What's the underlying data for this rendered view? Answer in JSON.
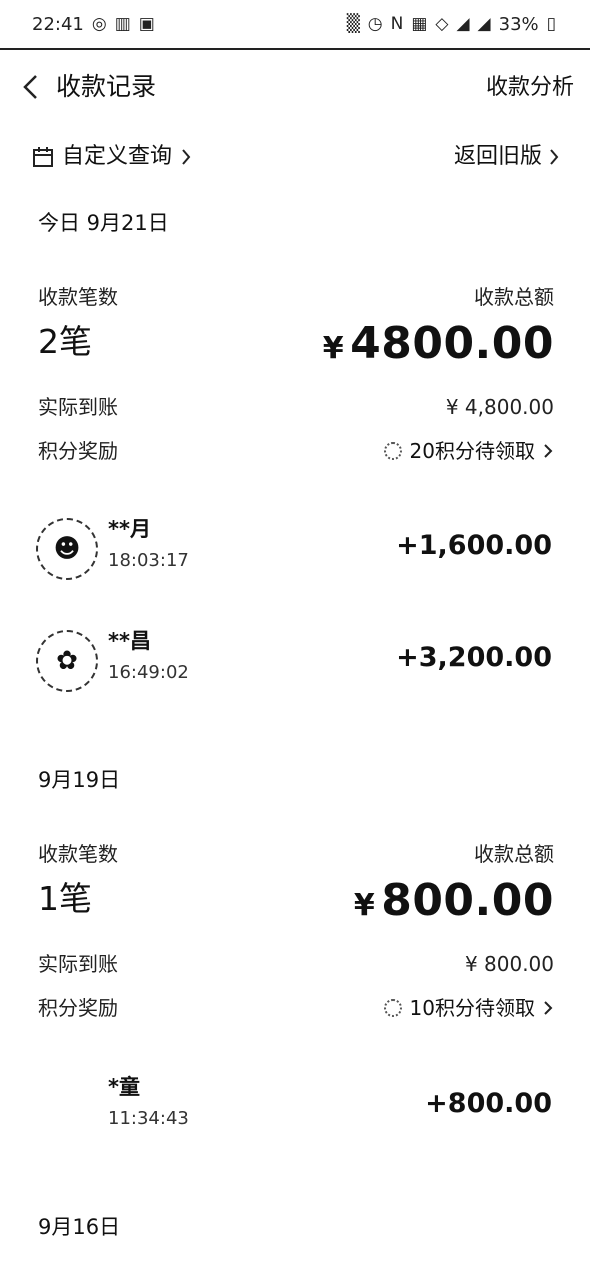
{
  "status_bar": {
    "time": "22:41",
    "battery": "33%"
  },
  "nav": {
    "title": "收款记录",
    "action": "收款分析"
  },
  "filters": {
    "custom_query": "自定义查询",
    "old_version": "返回旧版"
  },
  "sections": [
    {
      "date": "今日 9月21日",
      "count_label": "收款笔数",
      "count": "2笔",
      "total_label": "收款总额",
      "total": "4800.00",
      "received_label": "实际到账",
      "received": "¥ 4,800.00",
      "reward_label": "积分奖励",
      "reward": "20积分待领取",
      "transactions": [
        {
          "name": "**月",
          "time": "18:03:17",
          "amount": "+1,600.00"
        },
        {
          "name": "**昌",
          "time": "16:49:02",
          "amount": "+3,200.00"
        }
      ]
    },
    {
      "date": "9月19日",
      "count_label": "收款笔数",
      "count": "1笔",
      "total_label": "收款总额",
      "total": "800.00",
      "received_label": "实际到账",
      "received": "¥ 800.00",
      "reward_label": "积分奖励",
      "reward": "10积分待领取",
      "transactions": [
        {
          "name": "*童",
          "time": "11:34:43",
          "amount": "+800.00"
        }
      ]
    },
    {
      "date": "9月16日"
    }
  ],
  "currency_symbol": "¥"
}
